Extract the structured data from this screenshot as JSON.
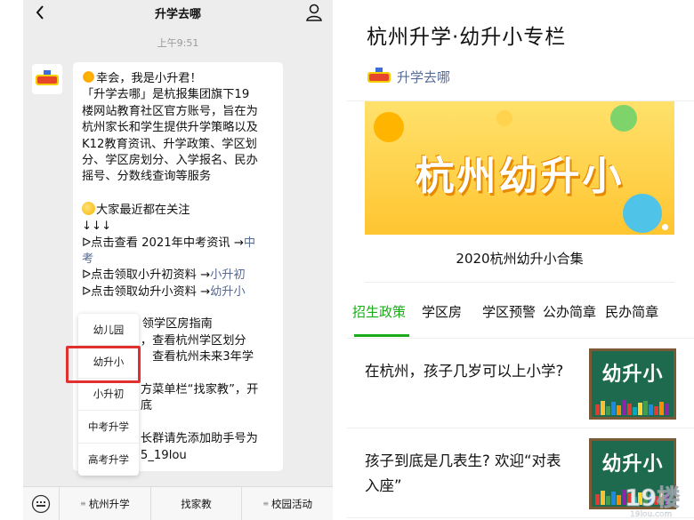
{
  "left": {
    "chat_title": "升学去哪",
    "timestamp": "上午9:51",
    "avatar_logo_text": "升学去哪",
    "message": {
      "greeting": "幸会，我是小升君！",
      "intro_lines": [
        "「升学去哪」是杭报集团旗下19",
        "楼网站教育社区官方账号，旨在为",
        "杭州家长和学生提供升学策略以及",
        "K12教育资讯、升学政策、学区划",
        "分、学区房划分、入学报名、民办",
        "摇号、分数线查询等服务"
      ],
      "focus_label": "大家最近都在关注",
      "arrows": "↓↓↓",
      "links": [
        {
          "prefix": "ᐅ点击查看 2021年中考资讯 →",
          "link": "中",
          "link2": "考"
        },
        {
          "prefix": "ᐅ点击领取小升初资料 →",
          "link": "小升初"
        },
        {
          "prefix": "ᐅ点击领取幼升小资料 →",
          "link": "幼升小"
        }
      ],
      "reply_lines": [
        "回复【2】，领学区房指南",
        "　　　　　，查看杭州学区划分",
        "　　　　　　查看杭州未来3年学",
        "　　　　　　",
        "　　　　　方菜单栏“找家教”，开",
        "　　　　　底",
        "　　　　　",
        "　　　　　长群请先添加助手号为",
        "　　　　　5_19lou"
      ]
    },
    "popup_menu": [
      "幼儿园",
      "幼升小",
      "小升初",
      "中考升学",
      "高考升学"
    ],
    "bottom_menu": [
      "杭州升学",
      "找家教",
      "校园活动"
    ]
  },
  "right": {
    "article_title": "杭州升学·幼升小专栏",
    "author_name": "升学去哪",
    "banner_text": "杭州幼升小",
    "banner_caption": "2020杭州幼升小合集",
    "tabs": [
      "招生政策",
      "学区房",
      "学区预警",
      "公办简章",
      "民办简章"
    ],
    "active_tab": "招生政策",
    "articles": [
      {
        "title": "在杭州，孩子几岁可以上小学?",
        "thumb_text": "幼升小"
      },
      {
        "title": "孩子到底是几表生? 欢迎“对表入座”",
        "thumb_text": "幼升小"
      }
    ],
    "watermark_text": "19楼",
    "watermark_sub": "19lou.com"
  },
  "colors": {
    "accent_green": "#1aad19",
    "link_blue": "#576b95",
    "highlight_red": "#e0302f",
    "banner_yellow": "#ffc531"
  }
}
